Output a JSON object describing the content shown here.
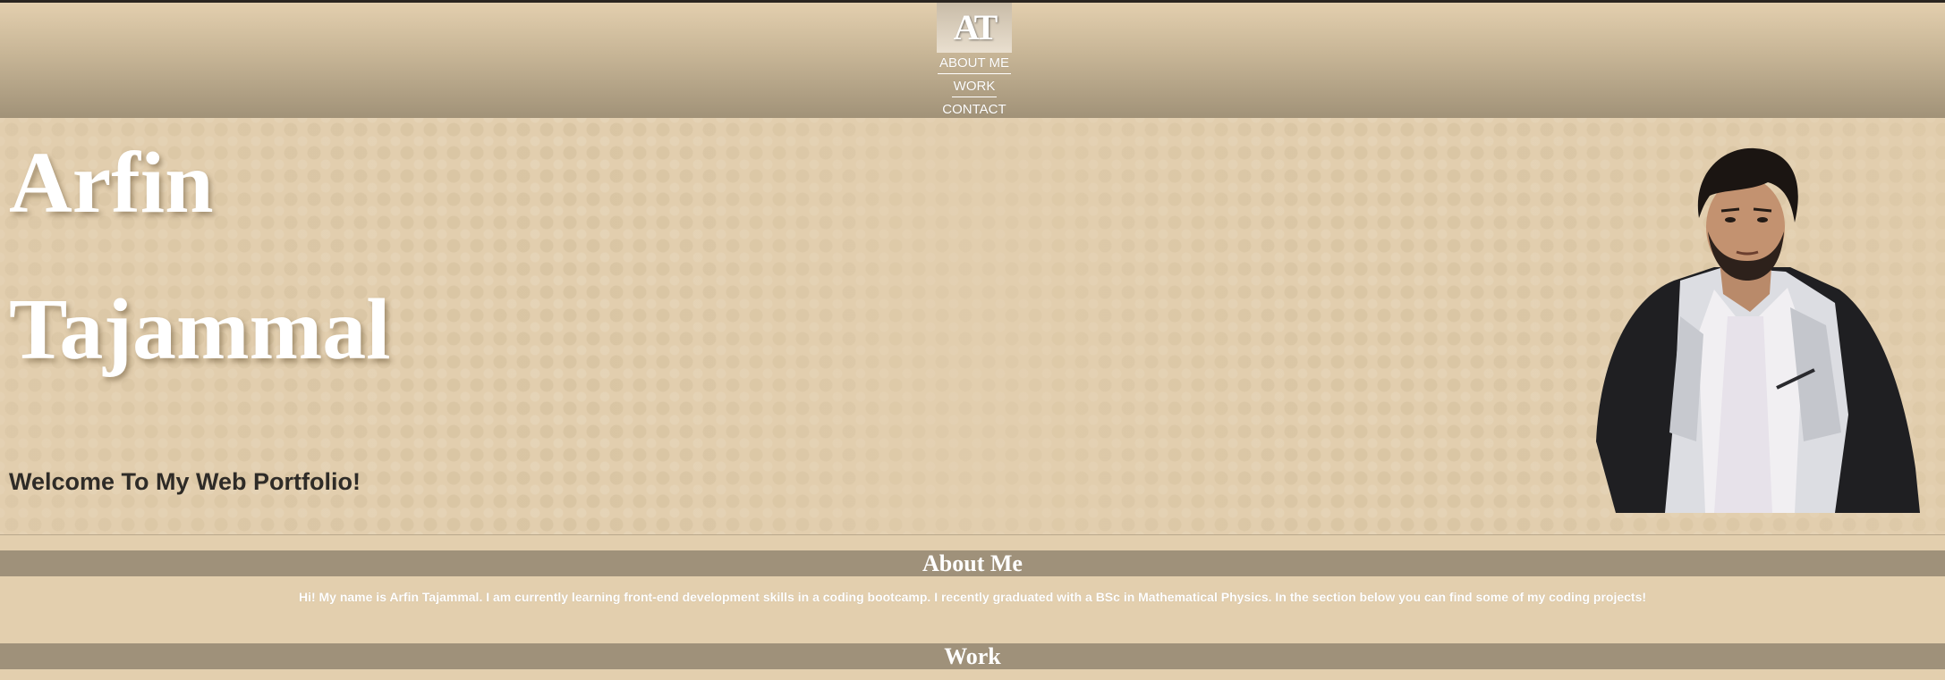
{
  "header": {
    "logo_text": "AT",
    "nav": [
      {
        "label": "ABOUT ME"
      },
      {
        "label": "WORK"
      },
      {
        "label": "CONTACT"
      }
    ]
  },
  "hero": {
    "first_name": "Arfin",
    "last_name": "Tajammal",
    "welcome": "Welcome To My Web Portfolio!",
    "portrait_icon": "profile-photo"
  },
  "about": {
    "heading": "About Me",
    "text": "Hi! My name is Arfin Tajammal. I am currently learning front-end development skills in a coding bootcamp. I recently graduated with a BSc in Mathematical Physics. In the section below you can find some of my coding projects!"
  },
  "work": {
    "heading": "Work"
  },
  "colors": {
    "background": "#e3cfae",
    "section_bar": "#9f917a",
    "header_bottom": "#a19278",
    "text_dark": "#2e2b27"
  }
}
